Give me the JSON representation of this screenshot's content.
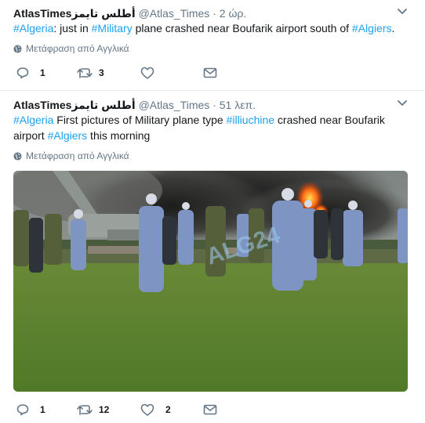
{
  "tweets": [
    {
      "name": "AtlasTimesأطلس تايمز",
      "handle": "@Atlas_Times",
      "dot": "·",
      "time": "2 ώρ.",
      "text_parts": [
        "#Algeria",
        ": just in ",
        "#Military",
        " plane crashed near Boufarik airport south of ",
        "#Algiers",
        "."
      ],
      "translate": "Μετάφραση από Αγγλικά",
      "replies": "1",
      "retweets": "3",
      "likes": ""
    },
    {
      "name": "AtlasTimesأطلس تايمز",
      "handle": "@Atlas_Times",
      "dot": "·",
      "time": "51 λεπ.",
      "text_parts": [
        "#Algeria",
        " First pictures of Military plane type ",
        "#illiuchine",
        " crashed near Boufarik airport ",
        "#Algiers",
        " this morning"
      ],
      "translate": "Μετάφραση από Αγγλικά",
      "watermark": "ALG24",
      "replies": "1",
      "retweets": "12",
      "likes": "2"
    }
  ],
  "icons": {
    "reply": "reply-icon",
    "retweet": "retweet-icon",
    "like": "heart-icon",
    "dm": "envelope-icon",
    "translate": "globe-icon",
    "menu": "chevron-down-icon"
  },
  "colors": {
    "link": "#1da1f2",
    "secondary": "#657786",
    "text": "#14171a",
    "divider": "#e6ecf0"
  }
}
